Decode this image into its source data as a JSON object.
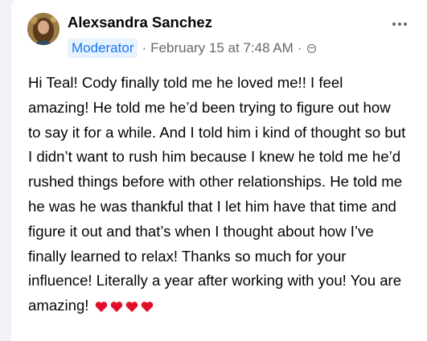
{
  "post": {
    "author": "Alexsandra Sanchez",
    "role_badge": "Moderator",
    "separator": "·",
    "timestamp": "February 15 at 7:48 AM",
    "audience_icon": "public-globe-icon",
    "more_icon": "more-options-icon",
    "body": "Hi Teal! Cody finally told me he loved me!! I feel amazing! He told me he’d been trying to figure out how to say it for a while. And I told him i kind of thought so but I didn’t want to rush him because I knew he told me he’d rushed things before with other relationships. He told me he was he was thankful that I let him have that time and figure it out and that’s when I thought about how I’ve finally learned to relax! Thanks so much for your influence! Literally a year after working with you! You are amazing!",
    "emoji": [
      "red-heart",
      "red-heart",
      "red-heart",
      "red-heart"
    ],
    "colors": {
      "badge_bg": "#e7f3ff",
      "badge_text": "#1877f2",
      "meta_text": "#65676b",
      "heart": "#e0102a"
    }
  }
}
